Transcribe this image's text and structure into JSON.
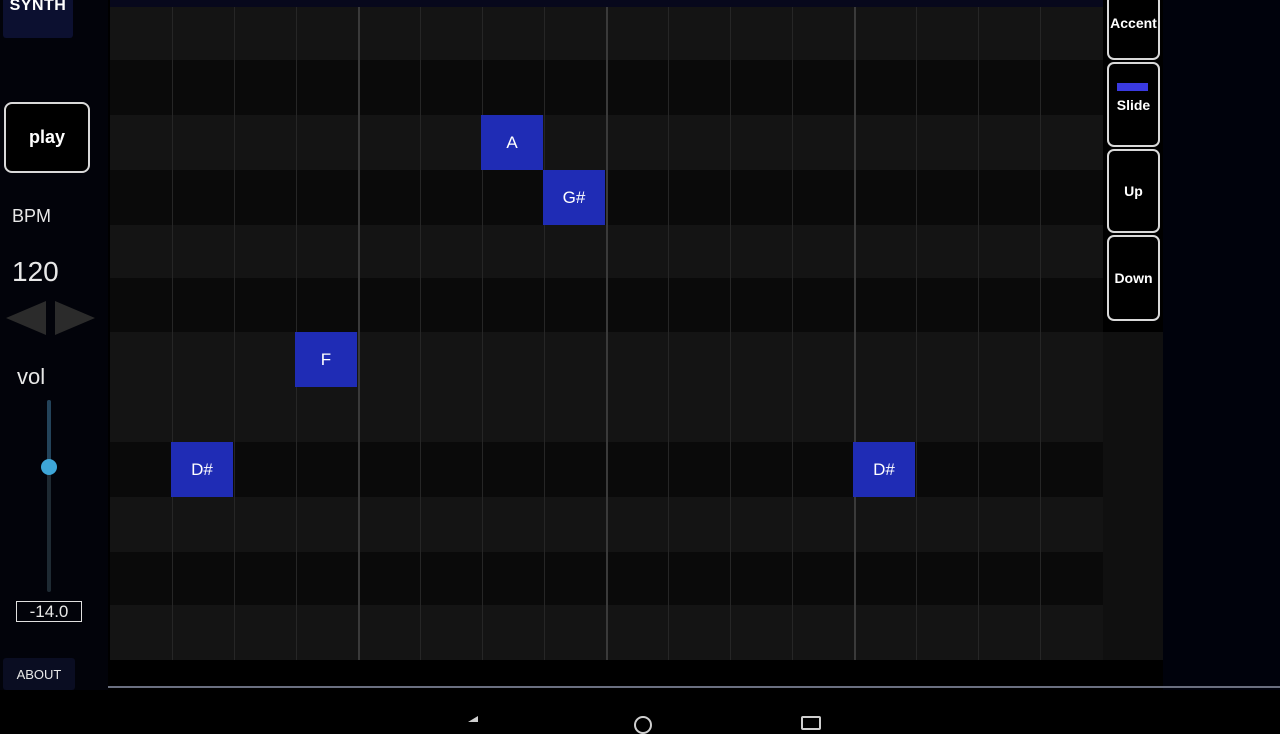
{
  "sidebar": {
    "synth_tab": "SYNTH",
    "play_label": "play",
    "bpm_label": "BPM",
    "bpm_value": "120",
    "vol_label": "vol",
    "vol_value": "-14.0",
    "about_label": "ABOUT"
  },
  "right_buttons": {
    "accent": "Accent",
    "slide": "Slide",
    "up": "Up",
    "down": "Down"
  },
  "notes": [
    {
      "label": "A",
      "step": 6,
      "row": 2
    },
    {
      "label": "G#",
      "step": 7,
      "row": 3
    },
    {
      "label": "F",
      "step": 3,
      "row": 6
    },
    {
      "label": "D#",
      "step": 1,
      "row": 8
    },
    {
      "label": "D#",
      "step": 12,
      "row": 8
    }
  ],
  "colors": {
    "note": "#1f2cb5",
    "accent_indicator": "#3a3ae0",
    "slider_thumb": "#3ea6d8"
  },
  "icons": [
    "back-icon",
    "home-icon",
    "recent-apps-icon"
  ]
}
